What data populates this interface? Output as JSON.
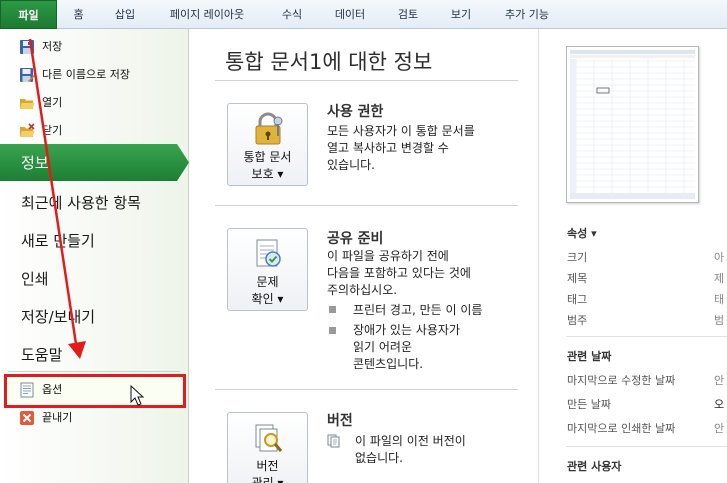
{
  "ribbon": {
    "tabs": [
      "파일",
      "홈",
      "삽입",
      "페이지 레이아웃",
      "수식",
      "데이터",
      "검토",
      "보기",
      "추가 기능"
    ]
  },
  "backstage": {
    "commands_top": [
      {
        "label": "저장",
        "icon": "save-icon"
      },
      {
        "label": "다른 이름으로 저장",
        "icon": "save-as-icon"
      },
      {
        "label": "열기",
        "icon": "open-folder-icon"
      },
      {
        "label": "닫기",
        "icon": "close-folder-icon"
      }
    ],
    "tabs": [
      "정보",
      "최근에 사용한 항목",
      "새로 만들기",
      "인쇄",
      "저장/보내기",
      "도움말"
    ],
    "active_tab": "정보",
    "commands_bottom": [
      {
        "label": "옵션",
        "icon": "options-icon"
      },
      {
        "label": "끝내기",
        "icon": "exit-icon"
      }
    ]
  },
  "info": {
    "title": "통합 문서1에 대한 정보",
    "permissions": {
      "button_line1": "통합 문서",
      "button_line2": "보호 ▾",
      "heading": "사용 권한",
      "text": [
        "모든 사용자가 이 통합 문서를",
        "열고 복사하고 변경할 수",
        "있습니다."
      ]
    },
    "prepare": {
      "button_line1": "문제",
      "button_line2": "확인 ▾",
      "heading": "공유 준비",
      "text": [
        "이 파일을 공유하기 전에",
        "다음을 포함하고 있다는 것에",
        "주의하십시오."
      ],
      "bullets": [
        [
          "프린터 경고, 만든 이 이름"
        ],
        [
          "장애가 있는 사용자가",
          "읽기 어려운",
          "콘텐츠입니다."
        ]
      ]
    },
    "versions": {
      "button_line1": "버전",
      "button_line2": "관리 ▾",
      "heading": "버전",
      "text": [
        "이 파일의 이전 버전이",
        "없습니다."
      ]
    }
  },
  "properties": {
    "heading": "속성 ▾",
    "rows": [
      {
        "label": "크기",
        "value": "아"
      },
      {
        "label": "제목",
        "value": "제"
      },
      {
        "label": "태그",
        "value": "태"
      },
      {
        "label": "범주",
        "value": "범"
      }
    ],
    "dates_heading": "관련 날짜",
    "date_rows": [
      {
        "label": "마지막으로 수정한 날짜",
        "value": "안"
      },
      {
        "label": "만든 날짜",
        "value": "오"
      },
      {
        "label": "마지막으로 인쇄한 날짜",
        "value": "안"
      }
    ],
    "people_heading": "관련 사용자"
  },
  "colors": {
    "file_tab": "#1f7f36",
    "active_tab": "#238a3b",
    "highlight_box": "#e31b1b",
    "annotation_arrow": "#e31b1b"
  }
}
